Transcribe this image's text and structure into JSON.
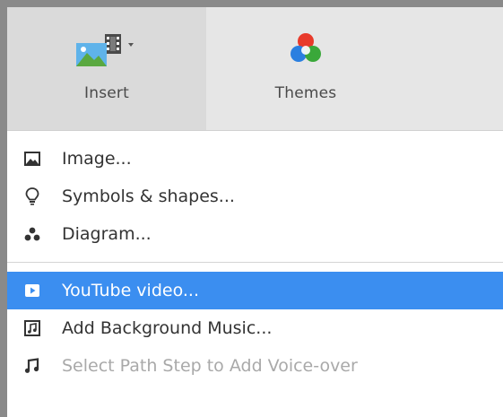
{
  "toolbar": {
    "insert": {
      "label": "Insert",
      "icon": "insert-media-icon"
    },
    "themes": {
      "label": "Themes",
      "icon": "themes-icon"
    }
  },
  "menu": {
    "groups": [
      [
        {
          "label": "Image...",
          "icon": "image-icon"
        },
        {
          "label": "Symbols & shapes...",
          "icon": "lightbulb-icon"
        },
        {
          "label": "Diagram...",
          "icon": "diagram-icon"
        }
      ],
      [
        {
          "label": "YouTube video...",
          "icon": "youtube-play-icon",
          "selected": true
        },
        {
          "label": "Add Background Music...",
          "icon": "music-file-icon"
        },
        {
          "label": "Select Path Step to Add Voice-over",
          "icon": "music-note-icon",
          "disabled": true
        }
      ]
    ]
  },
  "colors": {
    "selection": "#3b8ef0",
    "toolbar_bg": "#e6e6e6",
    "disabled_text": "#a9a9a9"
  }
}
